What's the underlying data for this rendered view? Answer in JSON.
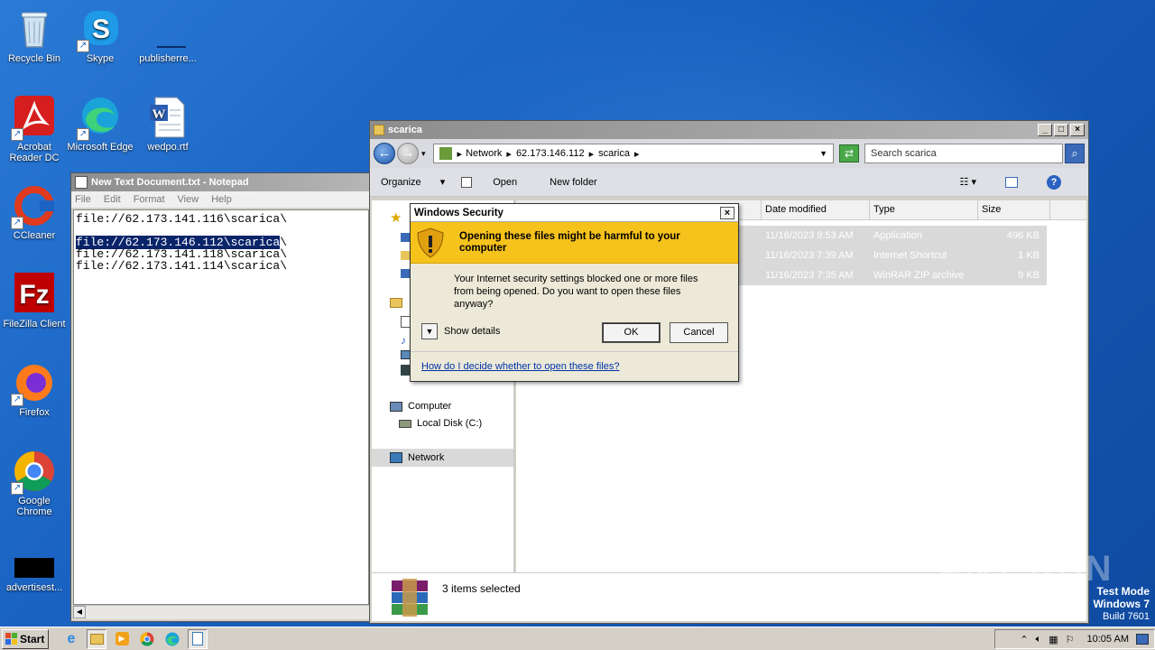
{
  "desktop": {
    "icons": [
      {
        "label": "Recycle Bin",
        "icon": "recycle-bin-icon"
      },
      {
        "label": "Skype",
        "icon": "skype-icon"
      },
      {
        "label": "publisherre...",
        "icon": "file-icon"
      },
      {
        "label": "Acrobat Reader DC",
        "icon": "acrobat-icon"
      },
      {
        "label": "Microsoft Edge",
        "icon": "edge-icon"
      },
      {
        "label": "wedpo.rtf",
        "icon": "word-document-icon"
      },
      {
        "label": "CCleaner",
        "icon": "ccleaner-icon"
      },
      {
        "label": "FileZilla Client",
        "icon": "filezilla-icon"
      },
      {
        "label": "Firefox",
        "icon": "firefox-icon"
      },
      {
        "label": "Google Chrome",
        "icon": "chrome-icon"
      },
      {
        "label": "advertisest...",
        "icon": "black-file-icon"
      }
    ]
  },
  "notepad": {
    "title": "New Text Document.txt - Notepad",
    "menu": [
      "File",
      "Edit",
      "Format",
      "View",
      "Help"
    ],
    "lines": [
      "file://62.173.141.116\\scarica\\",
      "",
      "file://62.173.146.112\\scarica\\",
      "file://62.173.141.118\\scarica\\",
      "file://62.173.141.114\\scarica\\"
    ],
    "selected_line": "file://62.173.146.112\\scarica",
    "selected_tail": "\\"
  },
  "explorer": {
    "title": "scarica",
    "breadcrumb": [
      "Network",
      "62.173.146.112",
      "scarica"
    ],
    "search_placeholder": "Search scarica",
    "toolbar": {
      "organize": "Organize",
      "open": "Open",
      "new_folder": "New folder"
    },
    "columns": [
      "Date modified",
      "Type",
      "Size"
    ],
    "rows": [
      {
        "date": "11/16/2023 9:53 AM",
        "type": "Application",
        "size": "496 KB"
      },
      {
        "date": "11/16/2023 7:39 AM",
        "type": "Internet Shortcut",
        "size": "1 KB"
      },
      {
        "date": "11/16/2023 7:35 AM",
        "type": "WinRAR ZIP archive",
        "size": "9 KB"
      }
    ],
    "nav": {
      "computer": "Computer",
      "local_disk": "Local Disk (C:)",
      "network": "Network"
    },
    "status": "3 items selected"
  },
  "dialog": {
    "title": "Windows Security",
    "heading": "Opening these files might be harmful to your computer",
    "body": "Your Internet security settings blocked one or more files from being opened. Do you want to open these files anyway?",
    "show_details": "Show details",
    "ok": "OK",
    "cancel": "Cancel",
    "link": "How do I decide whether to open these files?"
  },
  "taskbar": {
    "start": "Start",
    "clock": "10:05 AM"
  },
  "watermark": {
    "anyrun": "ANY RUN",
    "mode": "Test Mode",
    "os": "Windows 7",
    "build": "Build 7601"
  },
  "colors": {
    "dialog_band": "#f6c21c",
    "selection": "#0a246a"
  }
}
